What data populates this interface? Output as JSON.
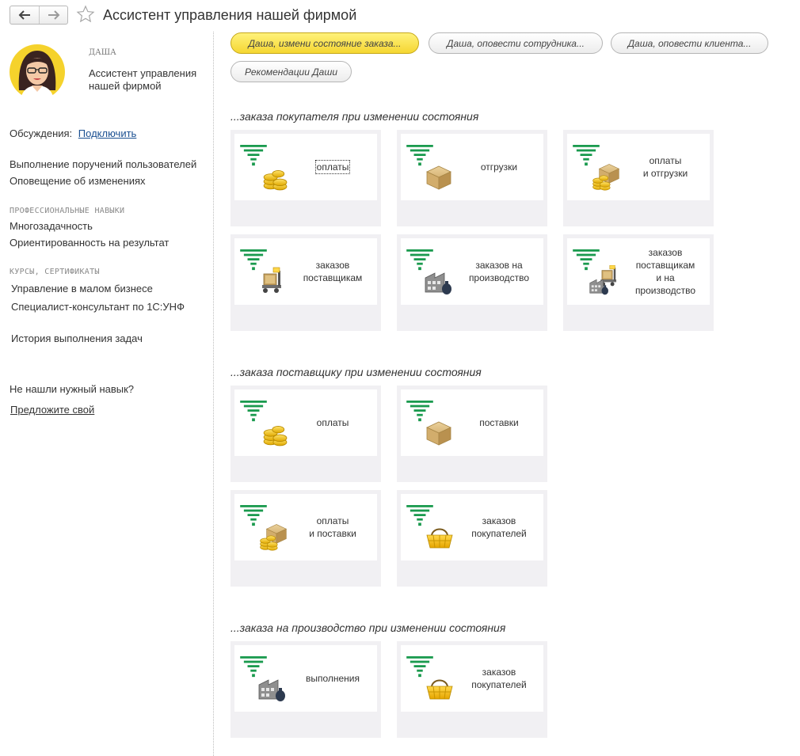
{
  "header": {
    "title": "Ассистент управления нашей фирмой"
  },
  "profile": {
    "name": "ДАША",
    "description": "Ассистент управления нашей фирмой"
  },
  "left": {
    "discussions_label": "Обсуждения:",
    "discussions_link": "Подключить",
    "duties": [
      "Выполнение поручений пользователей",
      "Оповещение об изменениях"
    ],
    "skills_header": "ПРОФЕССИОНАЛЬНЫЕ НАВЫКИ",
    "skills": [
      "Многозадачность",
      "Ориентированность на результат"
    ],
    "courses_header": "КУРСЫ, СЕРТИФИКАТЫ",
    "courses": [
      "Управление в малом бизнесе",
      "Специалист-консультант по 1С:УНФ"
    ],
    "history": "История выполнения задач",
    "not_found": "Не нашли нужный навык?",
    "suggest": "Предложите свой"
  },
  "actions": [
    "Даша, измени состояние заказа...",
    "Даша, оповести сотрудника...",
    "Даша, оповести клиента...",
    "Рекомендации Даши"
  ],
  "sections": [
    {
      "title": "...заказа покупателя при изменении состояния",
      "tiles": [
        {
          "label": "оплаты",
          "icon": "coins-icon"
        },
        {
          "label": "отгрузки",
          "icon": "box-icon"
        },
        {
          "label": "оплаты\nи отгрузки",
          "icon": "box-coins-icon"
        },
        {
          "label": "заказов\nпоставщикам",
          "icon": "pallet-truck-icon"
        },
        {
          "label": "заказов на\nпроизводство",
          "icon": "factory-icon"
        },
        {
          "label": "заказов\nпоставщикам\nи на\nпроизводство",
          "icon": "truck-factory-icon"
        }
      ]
    },
    {
      "title": "...заказа поставщику при изменении состояния",
      "tiles": [
        {
          "label": "оплаты",
          "icon": "coins-icon"
        },
        {
          "label": "поставки",
          "icon": "box-icon"
        },
        {
          "label": "оплаты\nи поставки",
          "icon": "box-coins-icon"
        },
        {
          "label": "заказов\nпокупателей",
          "icon": "basket-icon"
        }
      ]
    },
    {
      "title": "...заказа на производство при изменении состояния",
      "tiles": [
        {
          "label": "выполнения",
          "icon": "factory-icon"
        },
        {
          "label": "заказов\nпокупателей",
          "icon": "basket-icon"
        }
      ]
    }
  ],
  "colors": {
    "accent_yellow": "#f5d632",
    "funnel_green": "#1a9a4e",
    "link_blue": "#1a4f91"
  }
}
